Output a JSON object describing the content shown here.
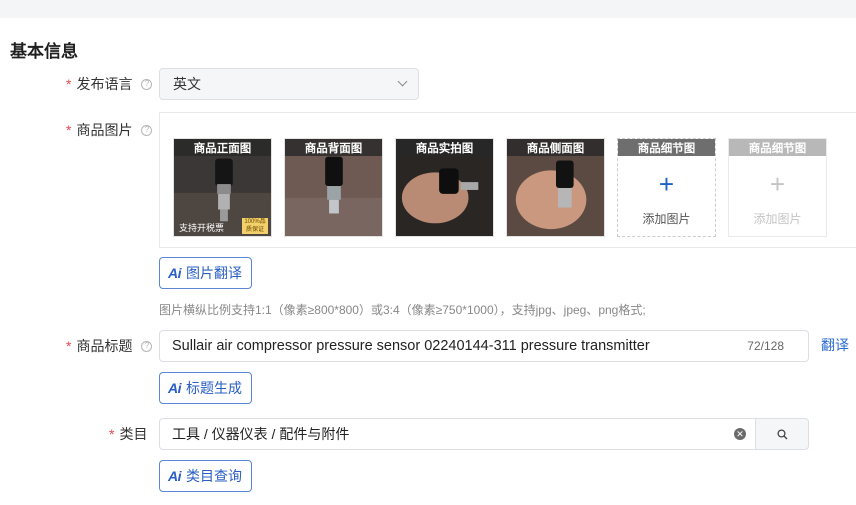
{
  "section": {
    "title": "基本信息"
  },
  "language": {
    "label": "发布语言",
    "value": "英文"
  },
  "images": {
    "label": "商品图片",
    "thumbs": [
      {
        "caption": "商品正面图",
        "tag": "支持开税票",
        "badge": "100%品质保证"
      },
      {
        "caption": "商品背面图"
      },
      {
        "caption": "商品实拍图"
      },
      {
        "caption": "商品侧面图"
      }
    ],
    "add_slots": [
      {
        "caption": "商品细节图",
        "text": "添加图片",
        "enabled": true
      },
      {
        "caption": "商品细节图",
        "text": "添加图片",
        "enabled": false
      }
    ],
    "ai_translate_label": "图片翻译",
    "hint": "图片横纵比例支持1:1（像素≥800*800）或3:4（像素≥750*1000），支持jpg、jpeg、png格式;"
  },
  "title": {
    "label": "商品标题",
    "value": "Sullair air compressor pressure sensor 02240144-311 pressure transmitter",
    "count": "72/128",
    "translate_link": "翻译",
    "ai_generate_label": "标题生成"
  },
  "category": {
    "label": "类目",
    "value": "工具 / 仪器仪表 / 配件与附件",
    "ai_query_label": "类目查询"
  },
  "ai_icon_text": "Ai",
  "required_mark": "*",
  "help_glyph": "?",
  "colors": {
    "primary": "#2a5fc4",
    "required": "#e5484d",
    "border": "#dcdfe6"
  }
}
